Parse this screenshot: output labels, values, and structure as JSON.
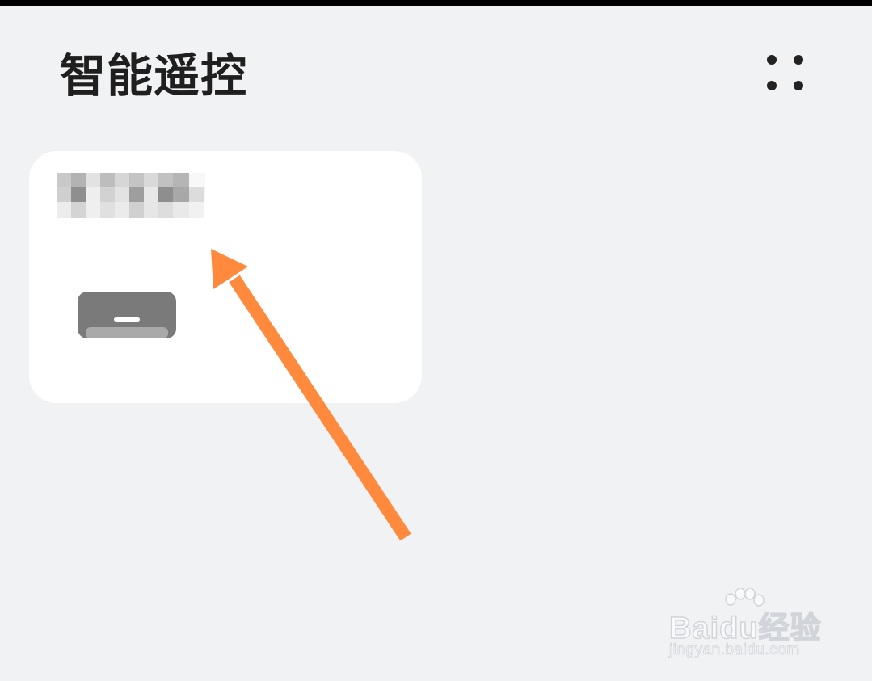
{
  "header": {
    "title": "智能遥控",
    "more_icon": "grid-dots-icon"
  },
  "device_card": {
    "name_redacted": true,
    "device_icon": "air-conditioner-icon"
  },
  "annotation": {
    "arrow_color": "#ff8a3d"
  },
  "watermark": {
    "logo": "Baidu经验",
    "url": "jingyan.baidu.com"
  },
  "colors": {
    "background": "#f1f2f4",
    "card": "#ffffff",
    "title": "#1f1f1f",
    "device_icon": "#7a7a7a"
  }
}
